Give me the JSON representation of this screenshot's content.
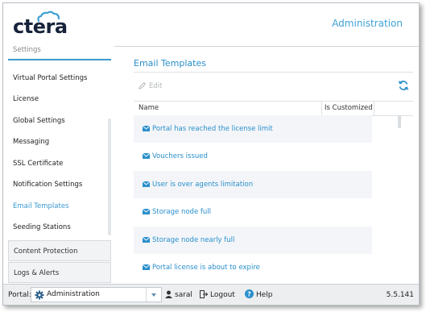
{
  "header": {
    "logo_text": "ctera",
    "section_title": "Administration"
  },
  "sidebar": {
    "partial_item": "Settings",
    "items": [
      {
        "label": "Virtual Portal Settings",
        "active": false
      },
      {
        "label": "License",
        "active": false
      },
      {
        "label": "Global Settings",
        "active": false
      },
      {
        "label": "Messaging",
        "active": false
      },
      {
        "label": "SSL Certificate",
        "active": false
      },
      {
        "label": "Notification Settings",
        "active": false
      },
      {
        "label": "Email Templates",
        "active": true
      },
      {
        "label": "Seeding Stations",
        "active": false
      }
    ],
    "groups": [
      {
        "label": "Content Protection"
      },
      {
        "label": "Logs & Alerts"
      }
    ]
  },
  "main": {
    "title": "Email Templates",
    "toolbar": {
      "edit_label": "Edit",
      "refresh_icon": "refresh-icon"
    },
    "table": {
      "columns": [
        "Name",
        "Is Customized"
      ],
      "rows": [
        {
          "name": "Portal has reached the license limit"
        },
        {
          "name": "Vouchers issued"
        },
        {
          "name": "User is over agents limitation"
        },
        {
          "name": "Storage node full"
        },
        {
          "name": "Storage node nearly full"
        },
        {
          "name": "Portal license is about to expire"
        }
      ]
    }
  },
  "footer": {
    "portal_label": "Portal:",
    "portal_value": "Administration",
    "user": "saral",
    "logout": "Logout",
    "help": "Help",
    "version": "5.5.141"
  },
  "colors": {
    "accent": "#3fa1d6",
    "link": "#2a8fcc",
    "brand_dark": "#17233a"
  }
}
